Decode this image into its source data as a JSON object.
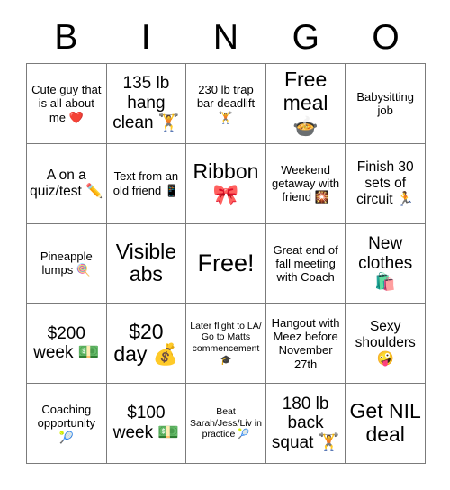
{
  "header": {
    "letters": [
      "B",
      "I",
      "N",
      "G",
      "O"
    ]
  },
  "grid": {
    "rows": 5,
    "columns": 5,
    "border_color": "#7b7b7b",
    "background_color": "#ffffff",
    "text_color": "#000000",
    "cells": [
      {
        "text": "Cute guy that is all about me ❤️",
        "size": "fs-sm"
      },
      {
        "text": "135 lb hang clean 🏋️",
        "size": "fs-lg"
      },
      {
        "text": "230 lb trap bar deadlift 🏋️",
        "size": "fs-sm"
      },
      {
        "text": "Free meal 🍲",
        "size": "fs-xl"
      },
      {
        "text": "Babysitting job",
        "size": "fs-sm"
      },
      {
        "text": "A on a quiz/test ✏️",
        "size": "fs-md"
      },
      {
        "text": "Text from an old friend 📱",
        "size": "fs-sm"
      },
      {
        "text": "Ribbon 🎀",
        "size": "fs-xl"
      },
      {
        "text": "Weekend getaway with friend 🎇",
        "size": "fs-sm"
      },
      {
        "text": "Finish 30 sets of circuit 🏃",
        "size": "fs-md"
      },
      {
        "text": "Pineapple lumps 🍭",
        "size": "fs-sm"
      },
      {
        "text": "Visible abs",
        "size": "fs-xl"
      },
      {
        "text": "Free!",
        "size": "fs-xxl"
      },
      {
        "text": "Great end of fall meeting with Coach",
        "size": "fs-sm"
      },
      {
        "text": "New clothes 🛍️",
        "size": "fs-lg"
      },
      {
        "text": "$200 week 💵",
        "size": "fs-lg"
      },
      {
        "text": "$20 day 💰",
        "size": "fs-xl"
      },
      {
        "text": "Later flight to LA/ Go to Matts commencement 🎓",
        "size": "fs-xs"
      },
      {
        "text": "Hangout with Meez before November 27th",
        "size": "fs-sm"
      },
      {
        "text": "Sexy shoulders 🤪",
        "size": "fs-md"
      },
      {
        "text": "Coaching opportunity 🎾",
        "size": "fs-sm"
      },
      {
        "text": "$100 week 💵",
        "size": "fs-lg"
      },
      {
        "text": "Beat Sarah/Jess/Liv in practice 🎾",
        "size": "fs-xs"
      },
      {
        "text": "180 lb back squat 🏋️",
        "size": "fs-lg"
      },
      {
        "text": "Get NIL deal",
        "size": "fs-xl"
      }
    ]
  }
}
